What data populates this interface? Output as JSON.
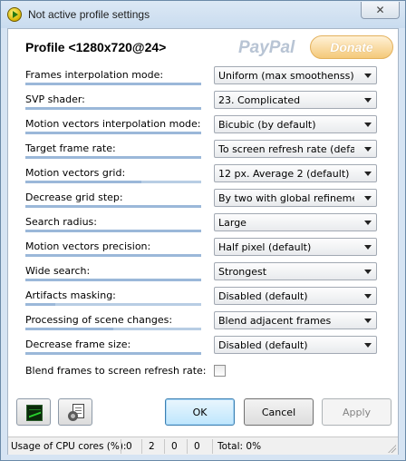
{
  "window": {
    "title": "Not active profile settings",
    "close_label": "✕"
  },
  "profile": {
    "title": "Profile <1280x720@24>",
    "paypal_label": "PayPal",
    "donate_label": "Donate"
  },
  "settings": [
    {
      "label": "Frames interpolation mode:",
      "value": "Uniform (max smoothenss)",
      "level": 1.0
    },
    {
      "label": "SVP shader:",
      "value": "23. Complicated",
      "level": 1.0
    },
    {
      "label": "Motion vectors interpolation mode:",
      "value": "Bicubic (by default)",
      "level": 1.0
    },
    {
      "label": "Target frame rate:",
      "value": "To screen refresh rate (default)",
      "level": 1.0
    },
    {
      "label": "Motion vectors grid:",
      "value": "12 px. Average 2 (default)",
      "level": 0.66
    },
    {
      "label": "Decrease grid step:",
      "value": "By two with global refinemen",
      "level": 1.0
    },
    {
      "label": "Search radius:",
      "value": "Large",
      "level": 1.0
    },
    {
      "label": "Motion vectors precision:",
      "value": "Half pixel (default)",
      "level": 1.0
    },
    {
      "label": "Wide search:",
      "value": "Strongest",
      "level": 1.0
    },
    {
      "label": "Artifacts masking:",
      "value": "Disabled (default)",
      "level": 0.17
    },
    {
      "label": "Processing of scene changes:",
      "value": "Blend adjacent frames",
      "level": 0.5
    },
    {
      "label": "Decrease frame size:",
      "value": "Disabled (default)",
      "level": 1.0
    }
  ],
  "blend": {
    "label": "Blend frames to screen refresh rate:",
    "checked": false
  },
  "buttons": {
    "ok": "OK",
    "cancel": "Cancel",
    "apply": "Apply"
  },
  "status": {
    "cpu_label": "Usage of CPU cores (%):",
    "cores": [
      "0",
      "2",
      "0",
      "0"
    ],
    "total": "Total: 0%"
  },
  "colors": {
    "bar_track": "#b8cde4",
    "bar_fill": "#9bb8d9",
    "ok_border": "#3c7fb1"
  }
}
